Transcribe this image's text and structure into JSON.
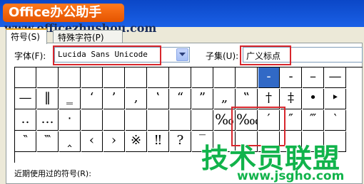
{
  "watermark": {
    "logo": "Office办公助手",
    "url": "www.officezhushou.com",
    "site_cn": "技术员联盟",
    "site_url": "www.jsgho.com"
  },
  "tabs": [
    {
      "label": "符号(S)",
      "active": true
    },
    {
      "label": "特殊字符(P)",
      "active": false
    }
  ],
  "font": {
    "label": "字体(F):",
    "value": "Lucida Sans Unicode"
  },
  "subset": {
    "label": "子集(U):",
    "value": "广义标点"
  },
  "symbols": {
    "row1": [
      "",
      "",
      "",
      "",
      "",
      "",
      "",
      "",
      "",
      "",
      "",
      "-",
      "-",
      "–",
      "—"
    ],
    "row2": [
      "—",
      "‖",
      "‗",
      "‘",
      "’",
      "‚",
      "‛",
      "“",
      "”",
      "„",
      "‟",
      "†",
      "‡",
      "•",
      "‣"
    ],
    "row3": [
      "‥",
      "…",
      "‧",
      "",
      "",
      "",
      "",
      "",
      "",
      "‰",
      "‱",
      "′",
      "″",
      "‴",
      "‵"
    ],
    "row4": [
      "‶",
      "‷",
      "‸",
      "‹",
      "›",
      "※",
      "‼",
      "?",
      "‾",
      "",
      "",
      "",
      "",
      "",
      ""
    ]
  },
  "recent_label": "近期使用过的符号(R):",
  "colors": {
    "selection": "#3169c6",
    "highlight": "#d8262c",
    "watermark_green": "#11b34b",
    "logo_orange": "#ff7a1e"
  }
}
